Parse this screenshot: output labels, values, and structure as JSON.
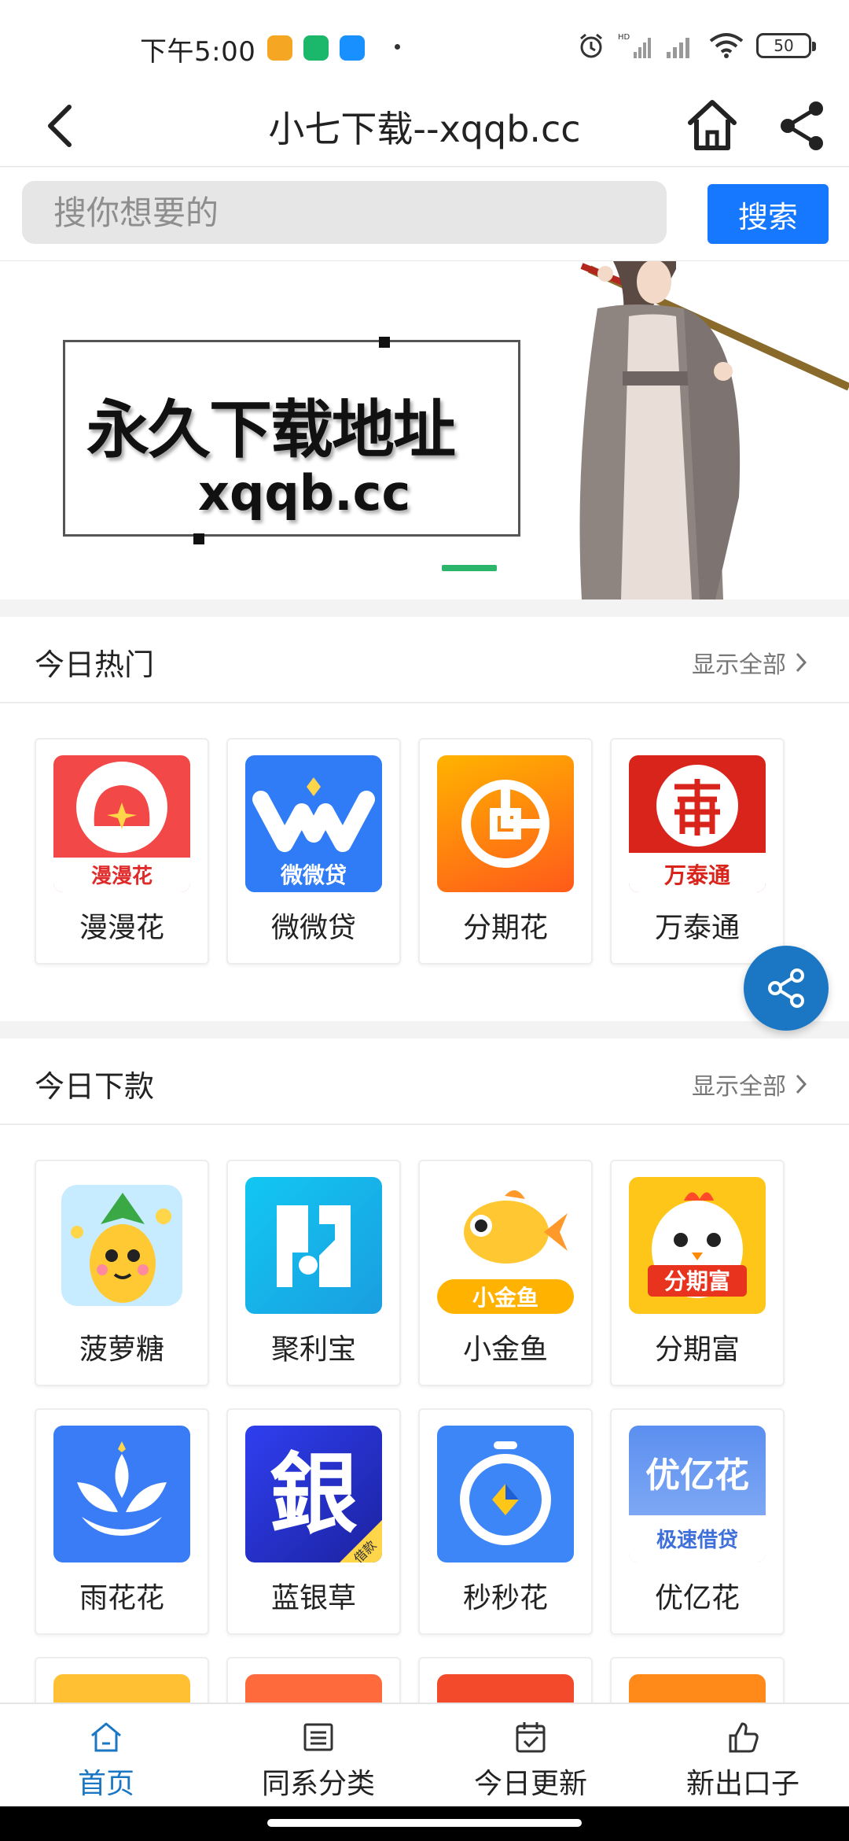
{
  "status": {
    "time": "下午5:00",
    "hd_label": "HD",
    "battery": "50",
    "app_icon_colors": [
      "#f5a623",
      "#1bb76a",
      "#1890ff"
    ]
  },
  "nav": {
    "title": "小七下载--xqqb.cc",
    "back_icon": "chevron-left-icon",
    "home_icon": "home-icon",
    "share_icon": "share-icon"
  },
  "search": {
    "placeholder": "搜你想要的",
    "button_label": "搜索"
  },
  "banner": {
    "headline": "永久下载地址",
    "url": "xqqb.cc",
    "indicator_color": "#2bb56b"
  },
  "hot_today": {
    "title": "今日热门",
    "show_all": "显示全部",
    "apps": [
      {
        "name": "漫漫花",
        "icon_text": "漫漫花",
        "color": "#f24848"
      },
      {
        "name": "微微贷",
        "icon_text": "微微贷",
        "color": "#2f7cf6"
      },
      {
        "name": "分期花",
        "icon_text": "",
        "color": "#ff7a1a"
      },
      {
        "name": "万泰通",
        "icon_text": "万泰通",
        "color": "#d9241c"
      }
    ]
  },
  "downloads_today": {
    "title": "今日下款",
    "show_all": "显示全部",
    "apps": [
      {
        "name": "菠萝糖",
        "icon_text": "",
        "color": "#bfe6ff"
      },
      {
        "name": "聚利宝",
        "icon_text": "",
        "color": "#1fb4e8"
      },
      {
        "name": "小金鱼",
        "icon_text": "小金鱼",
        "color": "#ffffff"
      },
      {
        "name": "分期富",
        "icon_text": "分期富",
        "color": "#ffc61a"
      },
      {
        "name": "雨花花",
        "icon_text": "",
        "color": "#3a7cf5"
      },
      {
        "name": "蓝银草",
        "icon_text": "銀",
        "badge": "借款",
        "color": "#2a39c7"
      },
      {
        "name": "秒秒花",
        "icon_text": "",
        "color": "#3d86f7"
      },
      {
        "name": "优亿花",
        "icon_text": "优亿花",
        "subtext": "极速借贷",
        "color": "#5b8ff0"
      }
    ]
  },
  "bottom_nav": [
    {
      "label": "首页",
      "icon": "home-icon",
      "active": true
    },
    {
      "label": "同系分类",
      "icon": "list-icon",
      "active": false
    },
    {
      "label": "今日更新",
      "icon": "calendar-check-icon",
      "active": false
    },
    {
      "label": "新出口子",
      "icon": "thumbs-up-icon",
      "active": false
    }
  ],
  "accent_color": "#1677ff"
}
